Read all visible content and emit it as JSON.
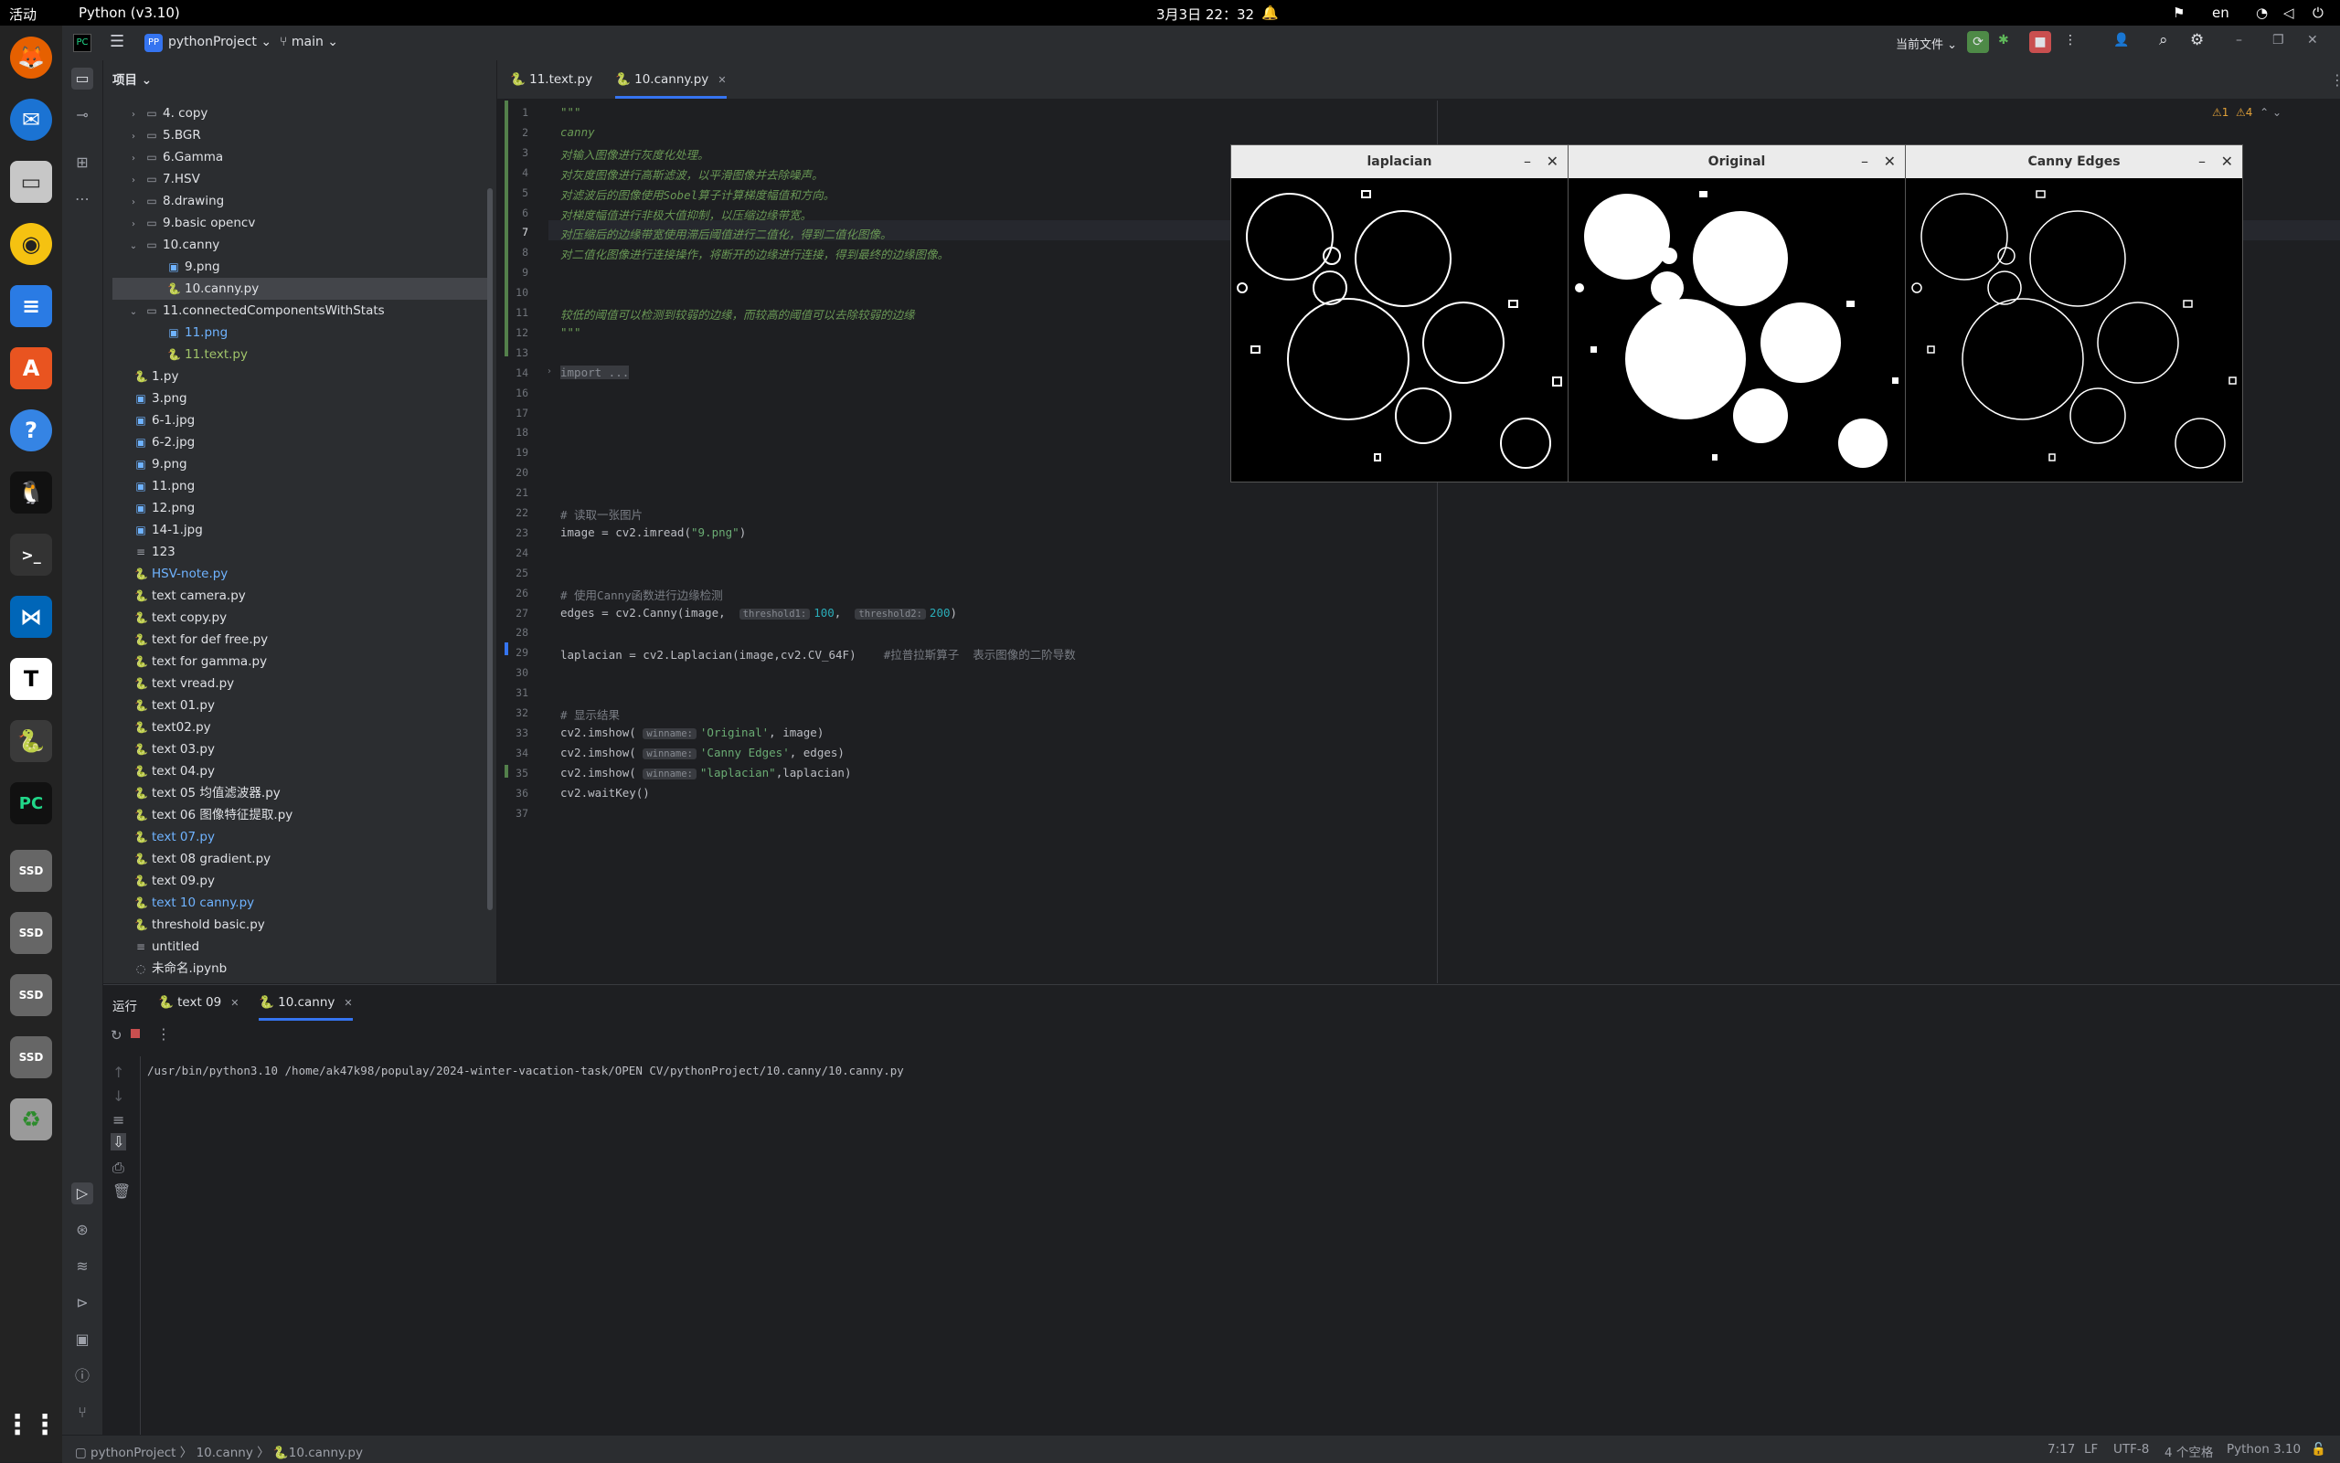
{
  "topbar": {
    "activities": "活动",
    "app": "Python (v3.10)",
    "clock": "3月3日  22：32",
    "lang": "en"
  },
  "ide": {
    "project": "pythonProject",
    "project_badge": "PP",
    "branch": "main",
    "run_config": "当前文件",
    "panel_label": "项目"
  },
  "tree": [
    {
      "depth": 1,
      "kind": "folder",
      "collapsed": true,
      "label": "4. copy"
    },
    {
      "depth": 1,
      "kind": "folder",
      "collapsed": true,
      "label": "5.BGR"
    },
    {
      "depth": 1,
      "kind": "folder",
      "collapsed": true,
      "label": "6.Gamma"
    },
    {
      "depth": 1,
      "kind": "folder",
      "collapsed": true,
      "label": "7.HSV"
    },
    {
      "depth": 1,
      "kind": "folder",
      "collapsed": true,
      "label": "8.drawing"
    },
    {
      "depth": 1,
      "kind": "folder",
      "collapsed": true,
      "label": "9.basic opencv"
    },
    {
      "depth": 1,
      "kind": "folder",
      "collapsed": false,
      "label": "10.canny"
    },
    {
      "depth": 2,
      "kind": "img",
      "label": "9.png"
    },
    {
      "depth": 2,
      "kind": "py",
      "label": "10.canny.py",
      "selected": true
    },
    {
      "depth": 1,
      "kind": "folder",
      "collapsed": false,
      "label": "11.connectedComponentsWithStats"
    },
    {
      "depth": 2,
      "kind": "img",
      "label": "11.png",
      "color": "#6fb3ff"
    },
    {
      "depth": 2,
      "kind": "py",
      "label": "11.text.py",
      "color": "#a0c46a"
    },
    {
      "depth": 1,
      "kind": "py",
      "label": "1.py",
      "noarrow": true
    },
    {
      "depth": 1,
      "kind": "img",
      "label": "3.png",
      "noarrow": true
    },
    {
      "depth": 1,
      "kind": "img",
      "label": "6-1.jpg",
      "noarrow": true
    },
    {
      "depth": 1,
      "kind": "img",
      "label": "6-2.jpg",
      "noarrow": true
    },
    {
      "depth": 1,
      "kind": "img",
      "label": "9.png",
      "noarrow": true
    },
    {
      "depth": 1,
      "kind": "img",
      "label": "11.png",
      "noarrow": true
    },
    {
      "depth": 1,
      "kind": "img",
      "label": "12.png",
      "noarrow": true
    },
    {
      "depth": 1,
      "kind": "img",
      "label": "14-1.jpg",
      "noarrow": true
    },
    {
      "depth": 1,
      "kind": "txt",
      "label": "123",
      "noarrow": true
    },
    {
      "depth": 1,
      "kind": "py",
      "label": "HSV-note.py",
      "noarrow": true,
      "color": "#6fb3ff"
    },
    {
      "depth": 1,
      "kind": "py",
      "label": "text camera.py",
      "noarrow": true
    },
    {
      "depth": 1,
      "kind": "py",
      "label": "text copy.py",
      "noarrow": true
    },
    {
      "depth": 1,
      "kind": "py",
      "label": "text for def free.py",
      "noarrow": true
    },
    {
      "depth": 1,
      "kind": "py",
      "label": "text for gamma.py",
      "noarrow": true
    },
    {
      "depth": 1,
      "kind": "py",
      "label": "text vread.py",
      "noarrow": true
    },
    {
      "depth": 1,
      "kind": "py",
      "label": "text 01.py",
      "noarrow": true
    },
    {
      "depth": 1,
      "kind": "py",
      "label": "text02.py",
      "noarrow": true
    },
    {
      "depth": 1,
      "kind": "py",
      "label": "text 03.py",
      "noarrow": true
    },
    {
      "depth": 1,
      "kind": "py",
      "label": "text 04.py",
      "noarrow": true
    },
    {
      "depth": 1,
      "kind": "py",
      "label": "text 05 均值滤波器.py",
      "noarrow": true
    },
    {
      "depth": 1,
      "kind": "py",
      "label": "text 06 图像特征提取.py",
      "noarrow": true
    },
    {
      "depth": 1,
      "kind": "py",
      "label": "text 07.py",
      "noarrow": true,
      "color": "#6fb3ff"
    },
    {
      "depth": 1,
      "kind": "py",
      "label": "text 08 gradient.py",
      "noarrow": true
    },
    {
      "depth": 1,
      "kind": "py",
      "label": "text 09.py",
      "noarrow": true
    },
    {
      "depth": 1,
      "kind": "py",
      "label": "text 10 canny.py",
      "noarrow": true,
      "color": "#6fb3ff"
    },
    {
      "depth": 1,
      "kind": "py",
      "label": "threshold  basic.py",
      "noarrow": true
    },
    {
      "depth": 1,
      "kind": "txt",
      "label": "untitled",
      "noarrow": true
    },
    {
      "depth": 1,
      "kind": "nb",
      "label": "未命名.ipynb",
      "noarrow": true
    }
  ],
  "tabs": [
    {
      "label": "11.text.py",
      "active": false
    },
    {
      "label": "10.canny.py",
      "active": true
    }
  ],
  "inspections": {
    "warnings_a": "1",
    "warnings_b": "4"
  },
  "code": [
    {
      "n": "1",
      "html": "<span class=\"c-com\">\"\"\"</span>"
    },
    {
      "n": "2",
      "html": "<span class=\"c-com\">canny</span>"
    },
    {
      "n": "3",
      "html": "<span class=\"c-com\">对输入图像进行灰度化处理。</span>"
    },
    {
      "n": "4",
      "html": "<span class=\"c-com\">对灰度图像进行高斯滤波，以平滑图像并去除噪声。</span>"
    },
    {
      "n": "5",
      "html": "<span class=\"c-com\">对滤波后的图像使用Sobel算子计算梯度幅值和方向。</span>"
    },
    {
      "n": "6",
      "html": "<span class=\"c-com\">对梯度幅值进行非极大值抑制，以压缩边缘带宽。</span>"
    },
    {
      "n": "7",
      "html": "<span class=\"c-com\">对压缩后的边缘带宽使用滞后阈值进行二值化，得到二值化图像。</span>"
    },
    {
      "n": "8",
      "html": "<span class=\"c-com\">对二值化图像进行连接操作，将断开的边缘进行连接，得到最终的边缘图像。</span>"
    },
    {
      "n": "9",
      "html": ""
    },
    {
      "n": "10",
      "html": ""
    },
    {
      "n": "11",
      "html": "<span class=\"c-com\">较低的阈值可以检测到较弱的边缘，而较高的阈值可以去除较弱的边缘</span>"
    },
    {
      "n": "12",
      "html": "<span class=\"c-com\">\"\"\"</span>"
    },
    {
      "n": "13",
      "html": ""
    },
    {
      "n": "14",
      "html": "<span style=\"background:#393b40;color:#868a91\">import ...</span>"
    },
    {
      "n": "16",
      "html": ""
    },
    {
      "n": "17",
      "html": ""
    },
    {
      "n": "18",
      "html": ""
    },
    {
      "n": "19",
      "html": ""
    },
    {
      "n": "20",
      "html": ""
    },
    {
      "n": "21",
      "html": ""
    },
    {
      "n": "22",
      "html": "<span class=\"c-cm2\"># 读取一张图片</span>"
    },
    {
      "n": "23",
      "html": "image = cv2.imread(<span class=\"c-str\">\"9.png\"</span>)"
    },
    {
      "n": "24",
      "html": ""
    },
    {
      "n": "25",
      "html": ""
    },
    {
      "n": "26",
      "html": "<span class=\"c-cm2\"># 使用Canny函数进行边缘检测</span>"
    },
    {
      "n": "27",
      "html": "edges = cv2.Canny(image,  <span class=\"hint\">threshold1:</span><span class=\"c-num\">100</span>,  <span class=\"hint\">threshold2:</span><span class=\"c-num\">200</span>)"
    },
    {
      "n": "28",
      "html": ""
    },
    {
      "n": "29",
      "html": "laplacian = cv2.Laplacian(image,cv2.CV_64F)    <span class=\"c-cm2\">#拉普拉斯算子  表示图像的二阶导数</span>"
    },
    {
      "n": "30",
      "html": ""
    },
    {
      "n": "31",
      "html": ""
    },
    {
      "n": "32",
      "html": "<span class=\"c-cm2\"># 显示结果</span>"
    },
    {
      "n": "33",
      "html": "cv2.imshow( <span class=\"hint\">winname:</span><span class=\"c-str\">'Original'</span>, image)"
    },
    {
      "n": "34",
      "html": "cv2.imshow( <span class=\"hint\">winname:</span><span class=\"c-str\">'Canny Edges'</span>, edges)"
    },
    {
      "n": "35",
      "html": "cv2.imshow( <span class=\"hint\">winname:</span><span class=\"c-str\">\"laplacian\"</span>,laplacian)"
    },
    {
      "n": "36",
      "html": "cv2.waitKey()"
    },
    {
      "n": "37",
      "html": ""
    }
  ],
  "windows": {
    "laplacian": "laplacian",
    "original": "Original",
    "canny": "Canny Edges"
  },
  "run": {
    "title": "运行",
    "tabs": [
      {
        "label": "text 09",
        "active": false
      },
      {
        "label": "10.canny",
        "active": true
      }
    ],
    "output": "/usr/bin/python3.10 /home/ak47k98/populay/2024-winter-vacation-task/OPEN CV/pythonProject/10.canny/10.canny.py"
  },
  "status": {
    "crumb1": "pythonProject",
    "crumb2": "10.canny",
    "crumb3": "10.canny.py",
    "pos": "7:17",
    "eol": "LF",
    "enc": "UTF-8",
    "indent": "4 个空格",
    "interp": "Python 3.10"
  }
}
